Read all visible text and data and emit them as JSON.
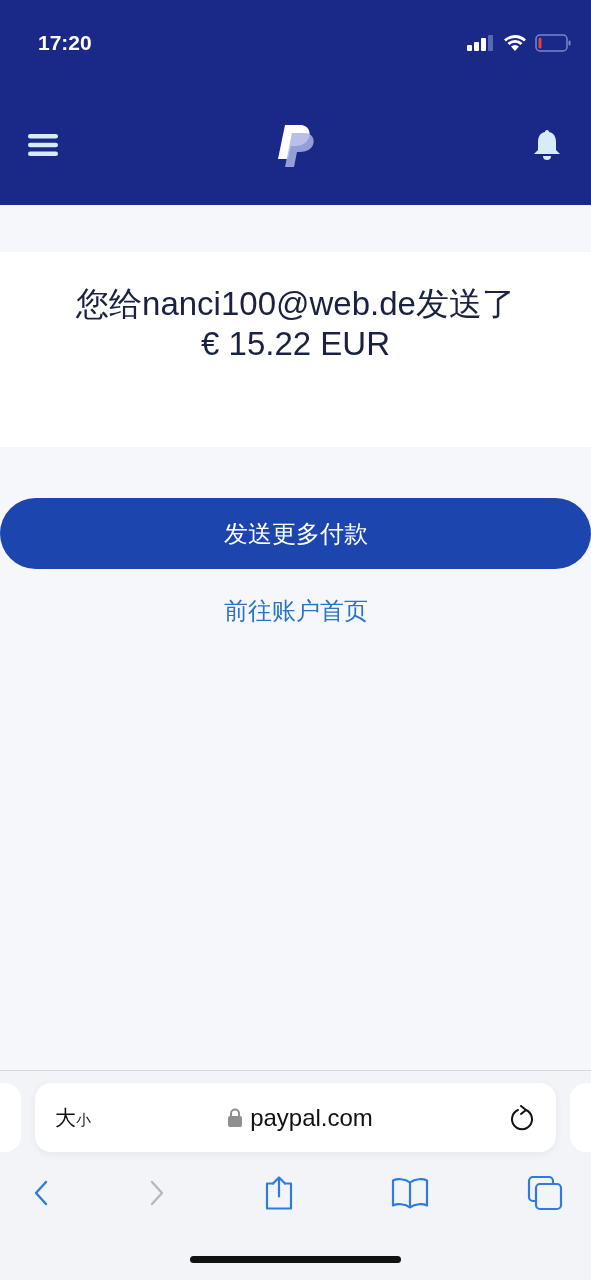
{
  "status_bar": {
    "time": "17:20"
  },
  "confirmation": {
    "message": "您给nanci100@web.de发送了",
    "amount": "€ 15.22 EUR"
  },
  "primary_button": {
    "label": "发送更多付款"
  },
  "secondary_link": {
    "label": "前往账户首页"
  },
  "browser": {
    "text_size_large": "大",
    "text_size_small": "小",
    "address": "paypal.com",
    "toolbar": [
      {
        "kind": "back",
        "disabled": false
      },
      {
        "kind": "forward",
        "disabled": true
      },
      {
        "kind": "share",
        "disabled": false
      },
      {
        "kind": "bookmarks",
        "disabled": false
      },
      {
        "kind": "tabs",
        "disabled": false
      }
    ]
  }
}
